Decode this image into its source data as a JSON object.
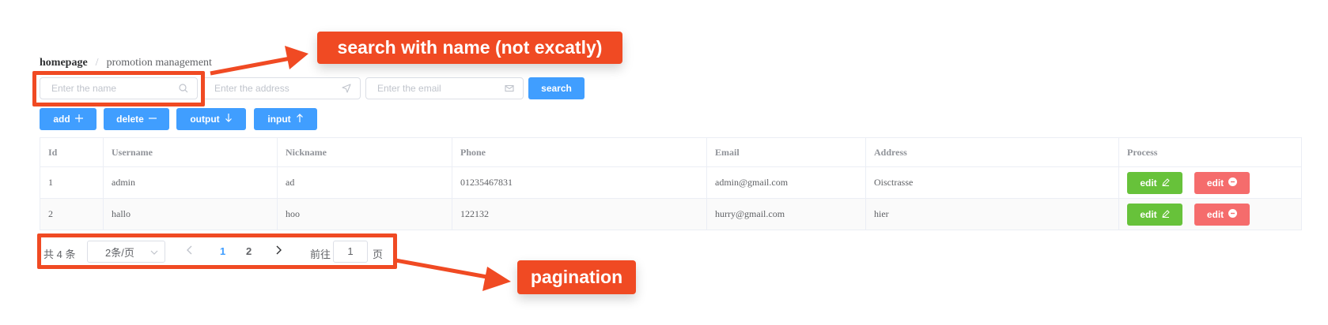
{
  "breadcrumb": {
    "home": "homepage",
    "separator": "/",
    "current": "promotion management"
  },
  "search": {
    "name_placeholder": "Enter the name",
    "address_placeholder": "Enter the address",
    "email_placeholder": "Enter the email",
    "button_label": "search"
  },
  "toolbar": {
    "add_label": "add",
    "delete_label": "delete",
    "output_label": "output",
    "input_label": "input"
  },
  "table": {
    "columns": [
      "Id",
      "Username",
      "Nickname",
      "Phone",
      "Email",
      "Address",
      "Process"
    ],
    "rows": [
      {
        "id": "1",
        "username": "admin",
        "nickname": "ad",
        "phone": "01235467831",
        "email": "admin@gmail.com",
        "address": "Oisctrasse",
        "edit_label": "edit",
        "delete_label": "edit"
      },
      {
        "id": "2",
        "username": "hallo",
        "nickname": "hoo",
        "phone": "122132",
        "email": "hurry@gmail.com",
        "address": "hier",
        "edit_label": "edit",
        "delete_label": "edit"
      }
    ]
  },
  "pagination": {
    "total": "共 4 条",
    "page_size": "2条/页",
    "pages": [
      "1",
      "2"
    ],
    "current_page": "1",
    "goto_label": "前往",
    "goto_value": "1",
    "page_suffix": "页"
  },
  "annotations": {
    "search_note": "search with name (not excatly)",
    "pagination_note": "pagination"
  },
  "colors": {
    "primary": "#409eff",
    "success": "#67c23a",
    "danger": "#f56c6c",
    "annotation": "#f04a23"
  }
}
